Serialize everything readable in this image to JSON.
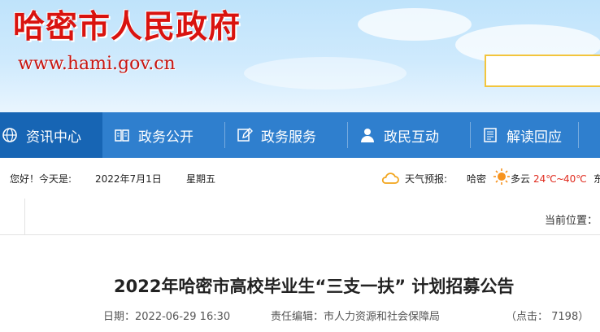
{
  "header": {
    "site_title": "哈密市人民政府",
    "site_url": "www.hami.gov.cn"
  },
  "nav": {
    "items": [
      {
        "label": "资讯中心",
        "icon": "globe-icon",
        "active": true
      },
      {
        "label": "政务公开",
        "icon": "book-icon"
      },
      {
        "label": "政务服务",
        "icon": "edit-icon"
      },
      {
        "label": "政民互动",
        "icon": "person-icon"
      },
      {
        "label": "解读回应",
        "icon": "document-icon"
      }
    ]
  },
  "infobar": {
    "greeting": "您好！今天是:",
    "date": "2022年7月1日",
    "weekday": "星期五",
    "weather_label": "天气预报:",
    "city": "哈密",
    "condition": "多云",
    "temp_low": "24℃",
    "temp_sep": "~",
    "temp_high": "40℃",
    "overflow_char": "东"
  },
  "breadcrumb": {
    "label": "当前位置："
  },
  "article": {
    "title": "2022年哈密市高校毕业生“三支一扶” 计划招募公告",
    "date_label": "日期：2022-06-29 16:30",
    "editor_label": "责任编辑：市人力资源和社会保障局",
    "clicks_label": "（点击： 7198）"
  },
  "colors": {
    "brand_red": "#d9130f",
    "nav_blue": "#2f7fce",
    "nav_active": "#1765b4",
    "temp_low": "#e02b1e",
    "temp_high": "#e02b1e"
  }
}
